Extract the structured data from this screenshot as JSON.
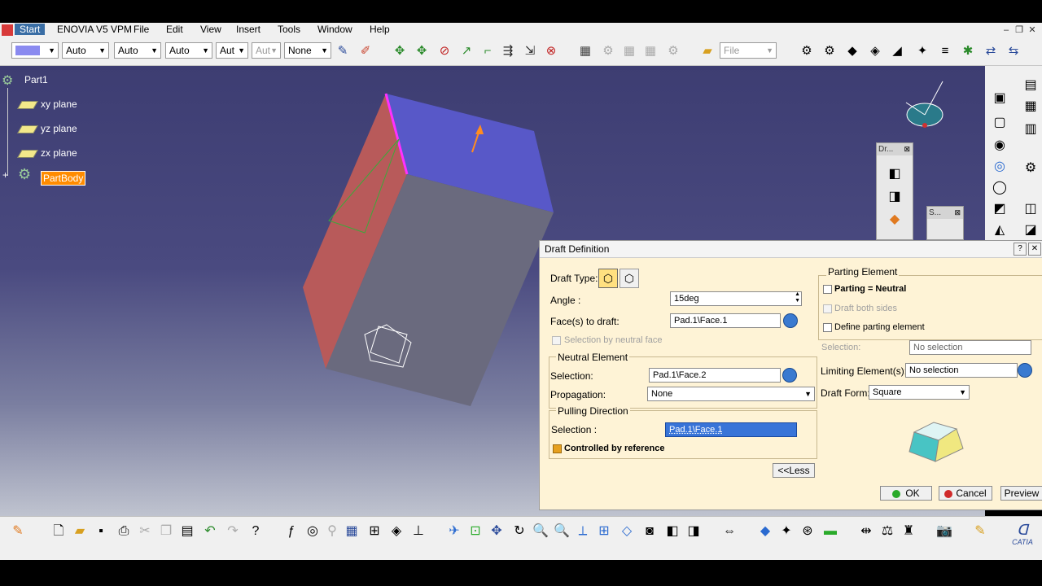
{
  "menu": {
    "start": "Start",
    "enovia": "ENOVIA V5 VPM",
    "file": "File",
    "edit": "Edit",
    "view": "View",
    "insert": "Insert",
    "tools": "Tools",
    "window": "Window",
    "help": "Help"
  },
  "toolbar": {
    "linetype_1": "Auto",
    "linetype_2": "Auto",
    "linetype_3": "Auto",
    "linetype_4": "Aut",
    "linetype_5": "Aut",
    "layer": "None",
    "file_select": "File"
  },
  "tree": {
    "root": "Part1",
    "xy": "xy plane",
    "yz": "yz plane",
    "zx": "zx plane",
    "body": "PartBody"
  },
  "floating": {
    "draft_tb": "Dr...",
    "sketch_tb": "S..."
  },
  "dialog": {
    "title": "Draft Definition",
    "draft_type_label": "Draft Type:",
    "angle_label": "Angle :",
    "angle_value": "15deg",
    "faces_label": "Face(s) to draft:",
    "faces_value": "Pad.1\\Face.1",
    "sel_neutral_face": "Selection by neutral face",
    "neutral_title": "Neutral Element",
    "neutral_sel_label": "Selection:",
    "neutral_sel_value": "Pad.1\\Face.2",
    "propagation_label": "Propagation:",
    "propagation_value": "None",
    "pulling_title": "Pulling Direction",
    "pulling_sel_label": "Selection :",
    "pulling_sel_value": "Pad.1\\Face.1",
    "controlled_by_ref": "Controlled by reference",
    "less_btn": "<<Less",
    "parting_title": "Parting Element",
    "parting_neutral": "Parting = Neutral",
    "draft_both_sides": "Draft both sides",
    "define_parting": "Define parting element",
    "parting_sel_label": "Selection:",
    "parting_sel_value": "No selection",
    "limiting_label": "Limiting Element(s):",
    "limiting_value": "No selection",
    "draft_form_label": "Draft Form:",
    "draft_form_value": "Square",
    "ok": "OK",
    "cancel": "Cancel",
    "preview": "Preview"
  },
  "colors": {
    "accent": "#3874d8",
    "tree_selected": "#ff8c00",
    "dialog_bg": "#fef3d6",
    "face_top": "#5858c8",
    "face_left": "#b85a5a",
    "face_front": "#6a6a7e"
  }
}
